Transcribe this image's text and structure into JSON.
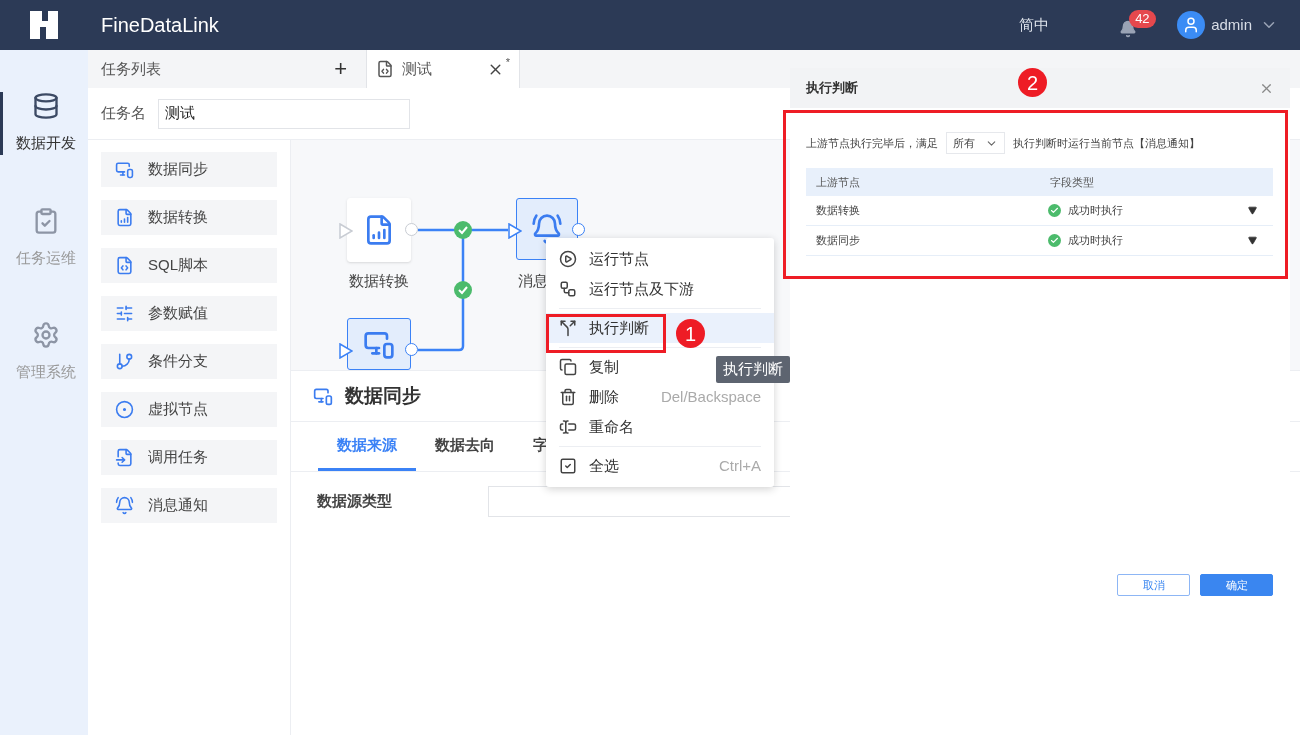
{
  "header": {
    "product": "FineDataLink",
    "language": "简中",
    "notification_count": "42",
    "user": "admin"
  },
  "nav": {
    "items": [
      {
        "label": "数据开发",
        "selected": true
      },
      {
        "label": "任务运维",
        "selected": false
      },
      {
        "label": "管理系统",
        "selected": false
      }
    ]
  },
  "task_list_tab": {
    "label": "任务列表",
    "add": "+"
  },
  "tabs": [
    {
      "label": "测试",
      "selected": true,
      "modified": "*"
    }
  ],
  "task_name": {
    "label": "任务名",
    "value": "测试"
  },
  "palette": {
    "items": [
      {
        "label": "数据同步"
      },
      {
        "label": "数据转换"
      },
      {
        "label": "SQL脚本"
      },
      {
        "label": "参数赋值"
      },
      {
        "label": "条件分支"
      },
      {
        "label": "虚拟节点"
      },
      {
        "label": "调用任务"
      },
      {
        "label": "消息通知"
      }
    ]
  },
  "canvas": {
    "nodes": [
      {
        "label": "数据转换",
        "selected": false
      },
      {
        "label": "消息",
        "selected": true
      },
      {
        "selected": true
      }
    ]
  },
  "context_menu": {
    "groups": [
      [
        {
          "label": "运行节点",
          "highlighted": false
        },
        {
          "label": "运行节点及下游",
          "highlighted": false
        }
      ],
      [
        {
          "label": "执行判断",
          "highlighted": true
        }
      ],
      [
        {
          "label": "复制",
          "highlighted": false
        },
        {
          "label": "删除",
          "shortcut": "Del/Backspace",
          "highlighted": false
        },
        {
          "label": "重命名",
          "highlighted": false
        }
      ],
      [
        {
          "label": "全选",
          "shortcut": "Ctrl+A",
          "highlighted": false
        }
      ]
    ]
  },
  "tooltip": "执行判断",
  "annotations": [
    "1",
    "2"
  ],
  "bottom_panel": {
    "title": "数据同步",
    "tabs": [
      {
        "label": "数据来源",
        "selected": true
      },
      {
        "label": "数据去向",
        "selected": false
      },
      {
        "label": "字",
        "selected": false
      }
    ],
    "field_label": "数据源类型"
  },
  "dialog": {
    "title": "执行判断",
    "condition_prefix": "上游节点执行完毕后，满足",
    "condition_value": "所有",
    "condition_suffix": "执行判断时运行当前节点【消息通知】",
    "table": {
      "columns": [
        "上游节点",
        "字段类型"
      ],
      "rows": [
        {
          "node": "数据转换",
          "condition": "成功时执行"
        },
        {
          "node": "数据同步",
          "condition": "成功时执行"
        }
      ]
    },
    "buttons": [
      {
        "label": "取消",
        "kind": "secondary"
      },
      {
        "label": "确定",
        "kind": "primary"
      }
    ]
  }
}
